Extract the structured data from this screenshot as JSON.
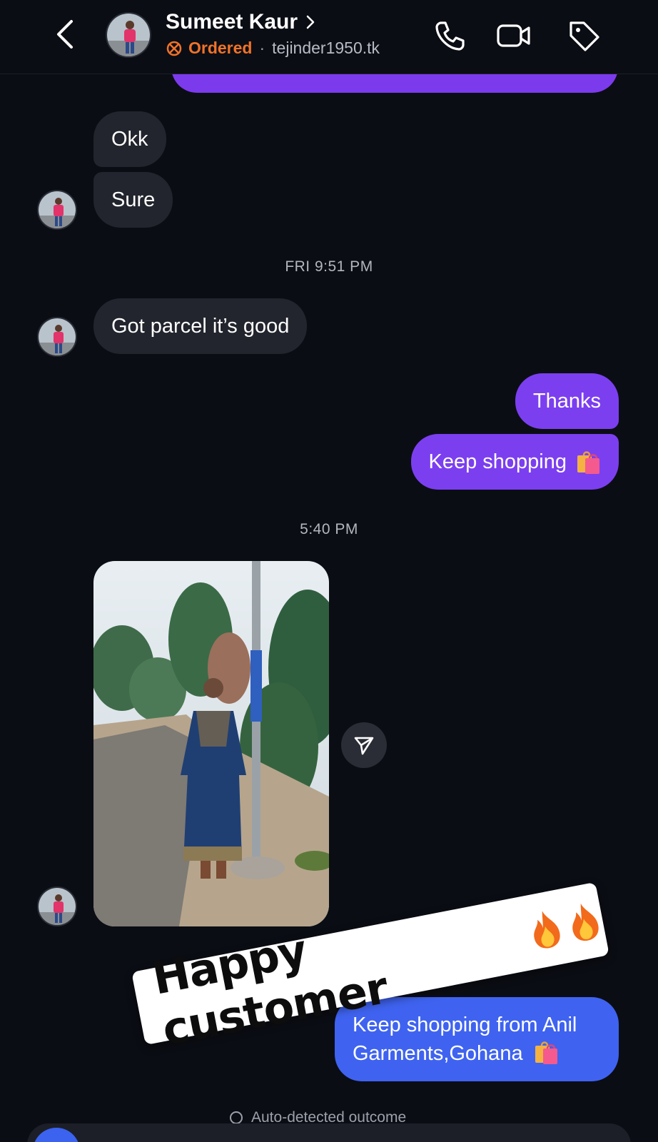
{
  "header": {
    "name": "Sumeet Kaur",
    "status": "Ordered",
    "separator": "·",
    "handle": "tejinder1950.tk"
  },
  "messages": [
    {
      "side": "incoming",
      "text": "Okk"
    },
    {
      "side": "incoming",
      "text": "Sure"
    },
    {
      "timestamp": "FRI 9:51 PM"
    },
    {
      "side": "incoming",
      "text": "Got parcel it’s good"
    },
    {
      "side": "outgoing",
      "text": "Thanks"
    },
    {
      "side": "outgoing",
      "text": "Keep shopping"
    },
    {
      "timestamp": "5:40 PM"
    },
    {
      "side": "outgoing",
      "text": "Keep shopping from Anil Garments,Gohana"
    }
  ],
  "sticker": {
    "text": "Happy customer"
  },
  "footer": {
    "outcome": "Auto-detected outcome"
  },
  "colors": {
    "accent_purple": "#7b3ff0",
    "accent_blue": "#3f63f0",
    "ordered": "#f0732a",
    "background": "#0b0d14"
  }
}
